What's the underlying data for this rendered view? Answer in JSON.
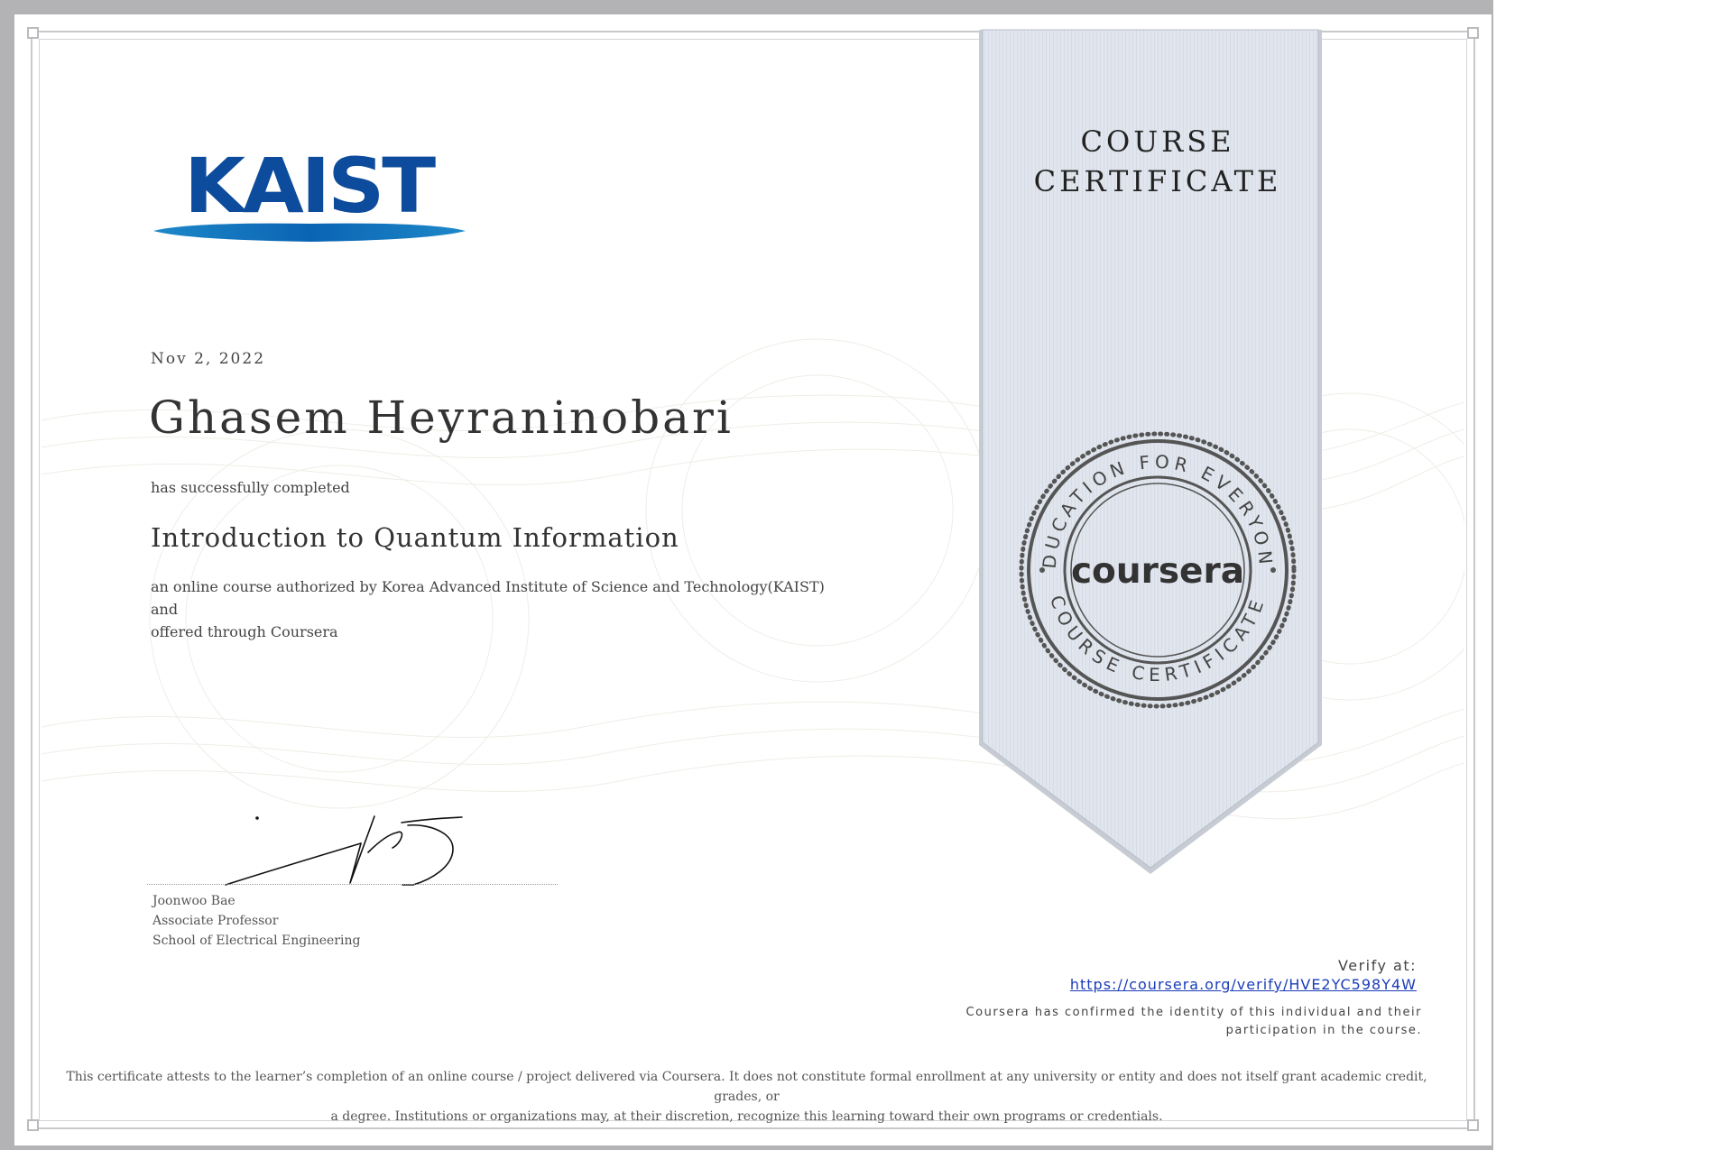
{
  "logo": {
    "text": "KAIST"
  },
  "ribbon": {
    "line1": "COURSE",
    "line2": "CERTIFICATE"
  },
  "seal": {
    "top_text": "EDUCATION FOR EVERYONE",
    "bottom_text": "COURSE CERTIFICATE",
    "center_text": "coursera"
  },
  "certificate": {
    "date": "Nov 2, 2022",
    "recipient_name": "Ghasem Heyraninobari",
    "completed_text": "has successfully completed",
    "course_title": "Introduction to Quantum Information",
    "description_line1": "an online course authorized by Korea Advanced Institute of Science and Technology(KAIST) and",
    "description_line2": "offered through Coursera"
  },
  "signer": {
    "name": "Joonwoo Bae",
    "title": "Associate Professor",
    "department": "School of Electrical Engineering"
  },
  "verify": {
    "label": "Verify at:",
    "url": "https://coursera.org/verify/HVE2YC598Y4W",
    "identity_line1": "Coursera has confirmed the identity of this individual and their",
    "identity_line2": "participation in the course."
  },
  "disclaimer": {
    "line1": "This certificate attests to the learner’s completion of an online course / project delivered via Coursera. It does not constitute formal enrollment at any university or entity and does not itself grant academic credit, grades, or",
    "line2": "a degree. Institutions or organizations may, at their discretion, recognize this learning toward their own programs or credentials."
  },
  "colors": {
    "kaist_blue": "#0d4b9c",
    "ribbon_fill": "#e1e6ee",
    "link_blue": "#1a3cb8",
    "frame_gray": "#b3b3b5"
  }
}
